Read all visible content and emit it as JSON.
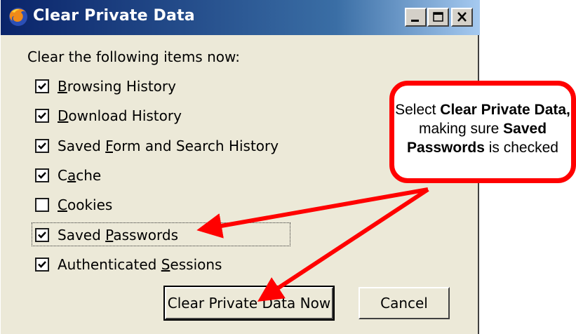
{
  "window": {
    "title": "Clear Private Data",
    "minimize_label": "Minimize",
    "maximize_label": "Maximize",
    "close_label": "Close"
  },
  "dialog": {
    "heading": "Clear the following items now:",
    "items": [
      {
        "pre": "",
        "accel": "B",
        "post": "rowsing History",
        "checked": true
      },
      {
        "pre": "",
        "accel": "D",
        "post": "ownload History",
        "checked": true
      },
      {
        "pre": "Saved ",
        "accel": "F",
        "post": "orm and Search History",
        "checked": true
      },
      {
        "pre": "C",
        "accel": "a",
        "post": "che",
        "checked": true
      },
      {
        "pre": "",
        "accel": "C",
        "post": "ookies",
        "checked": false
      },
      {
        "pre": "Saved ",
        "accel": "P",
        "post": "asswords",
        "checked": true
      },
      {
        "pre": "Authenticated ",
        "accel": "S",
        "post": "essions",
        "checked": true
      }
    ],
    "clear_button": "Clear Private Data Now",
    "cancel_button": "Cancel"
  },
  "callout": {
    "line1_pre": "Select ",
    "line1_bold": "Clear Private Data,",
    "line2_pre": "making sure ",
    "line2_bold": "Saved",
    "line3_bold": "Passwords",
    "line3_post": " is checked",
    "border_color": "#ff0000"
  },
  "colors": {
    "title_gradient_start": "#0a246a",
    "title_gradient_end": "#a6caf0",
    "dialog_bg": "#ece9d8",
    "arrow": "#ff0000"
  }
}
